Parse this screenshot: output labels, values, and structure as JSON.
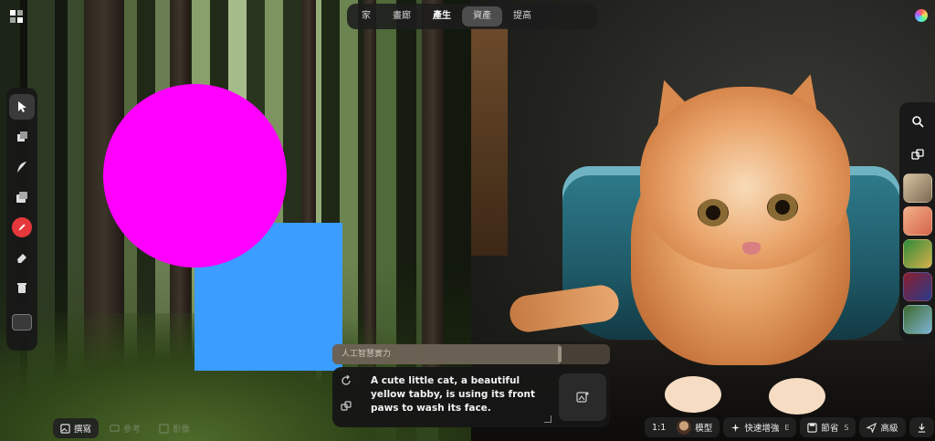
{
  "top_nav": {
    "tabs": [
      {
        "label": "家"
      },
      {
        "label": "畫廊"
      },
      {
        "label": "產生"
      },
      {
        "label": "資產"
      },
      {
        "label": "提高"
      }
    ],
    "active_index": 2
  },
  "canvas": {
    "shapes": {
      "circle_color": "#ff00ff",
      "square_color": "#3b9dff"
    }
  },
  "left_toolbar": {
    "tools": [
      "select-tool",
      "layers-tool",
      "brush-tool",
      "image-upload-tool",
      "color-picker-tool",
      "eraser-tool",
      "delete-tool",
      "background-tool"
    ],
    "active_color": "#e5383b"
  },
  "right_toolbar": {
    "styles": [
      {
        "name": "style-1",
        "color_a": "#d7c3a1",
        "color_b": "#7c6a52"
      },
      {
        "name": "style-2",
        "color_a": "#f3b08a",
        "color_b": "#d4644a"
      },
      {
        "name": "style-3",
        "color_a": "#2e8a3a",
        "color_b": "#d6b04a"
      },
      {
        "name": "style-4",
        "color_a": "#8b1e2e",
        "color_b": "#2a3a8a"
      },
      {
        "name": "style-5",
        "color_a": "#3d6a2a",
        "color_b": "#7db4d6"
      }
    ]
  },
  "prompt": {
    "strength_label": "人工智慧實力",
    "strength_value": 0.82,
    "text": "A cute little cat, a beautiful yellow tabby, is using its front paws to wash its face."
  },
  "bottom_left": {
    "items": [
      {
        "label": "撰寫",
        "active": true
      },
      {
        "label": "參考",
        "active": false
      },
      {
        "label": "影像",
        "active": false
      }
    ]
  },
  "bottom_right": {
    "aspect_ratio": "1:1",
    "model_label": "模型",
    "enhance_label": "快速增強",
    "enhance_key": "E",
    "save_label": "節省",
    "save_key": "S",
    "advanced_label": "高級"
  }
}
